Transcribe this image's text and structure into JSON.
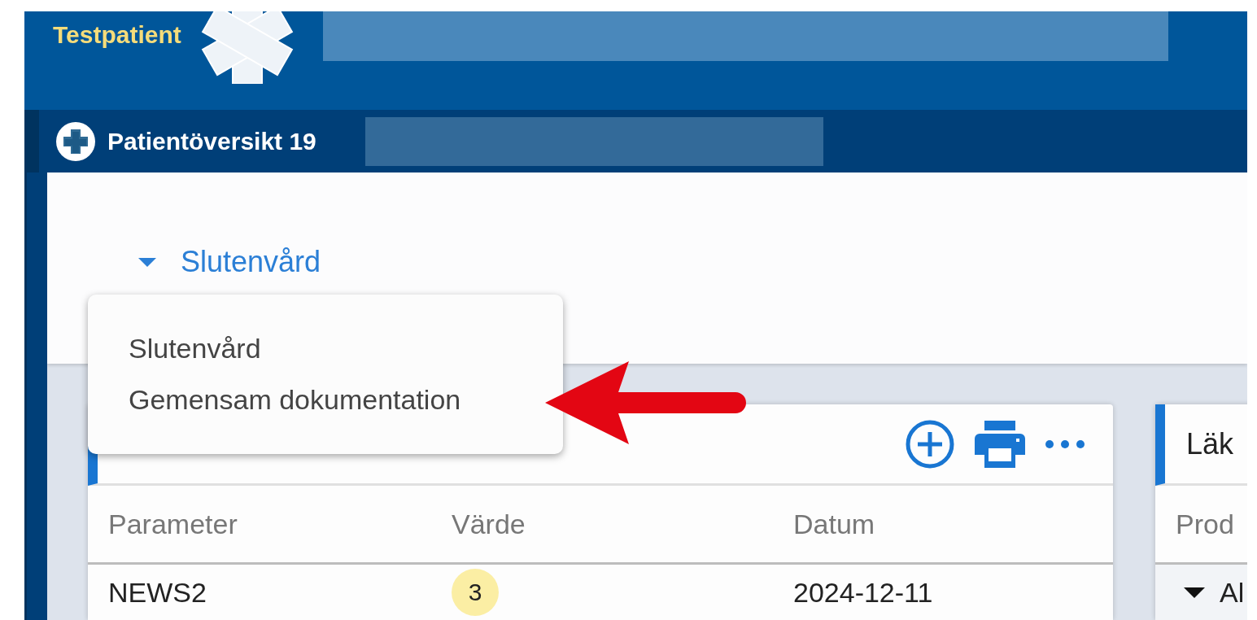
{
  "header": {
    "patient_name": "Testpatient"
  },
  "tab": {
    "title": "Patientöversikt 19"
  },
  "context_selector": {
    "label": "Slutenvård"
  },
  "dropdown_menu": {
    "items": [
      {
        "label": "Slutenvård"
      },
      {
        "label": "Gemensam dokumentation"
      }
    ]
  },
  "cards": [
    {
      "actions": [
        {
          "kind": "add"
        },
        {
          "kind": "print"
        },
        {
          "kind": "more"
        }
      ],
      "columns": [
        "Parameter",
        "Värde",
        "Datum"
      ],
      "rows": [
        {
          "cells": [
            {
              "kind": "text",
              "text": "NEWS2"
            },
            {
              "kind": "badge",
              "text": "3"
            },
            {
              "kind": "text",
              "text": "2024-12-11"
            }
          ]
        }
      ]
    },
    {
      "title": "Läk",
      "columns": [
        "Prod"
      ],
      "rows": [
        {
          "cells": [
            {
              "kind": "group",
              "text": "Al"
            }
          ]
        }
      ]
    }
  ]
}
